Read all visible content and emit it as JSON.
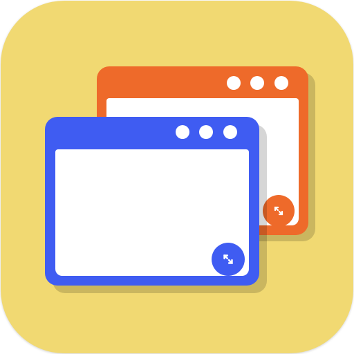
{
  "app_icon": {
    "icon_name": "multi-window-app-icon",
    "colors": {
      "background": "#F1D972",
      "back_window": "#EE6A2A",
      "front_window": "#3F5CF2",
      "window_content": "#FFFFFF",
      "resize_button_back": "#EE6A2A",
      "resize_button_front": "#3F5CF2"
    },
    "back_window": {
      "control_dots": [
        "dot",
        "dot",
        "dot"
      ],
      "resize_icon": "expand-arrows-icon"
    },
    "front_window": {
      "control_dots": [
        "dot",
        "dot",
        "dot"
      ],
      "resize_icon": "expand-arrows-icon"
    }
  }
}
